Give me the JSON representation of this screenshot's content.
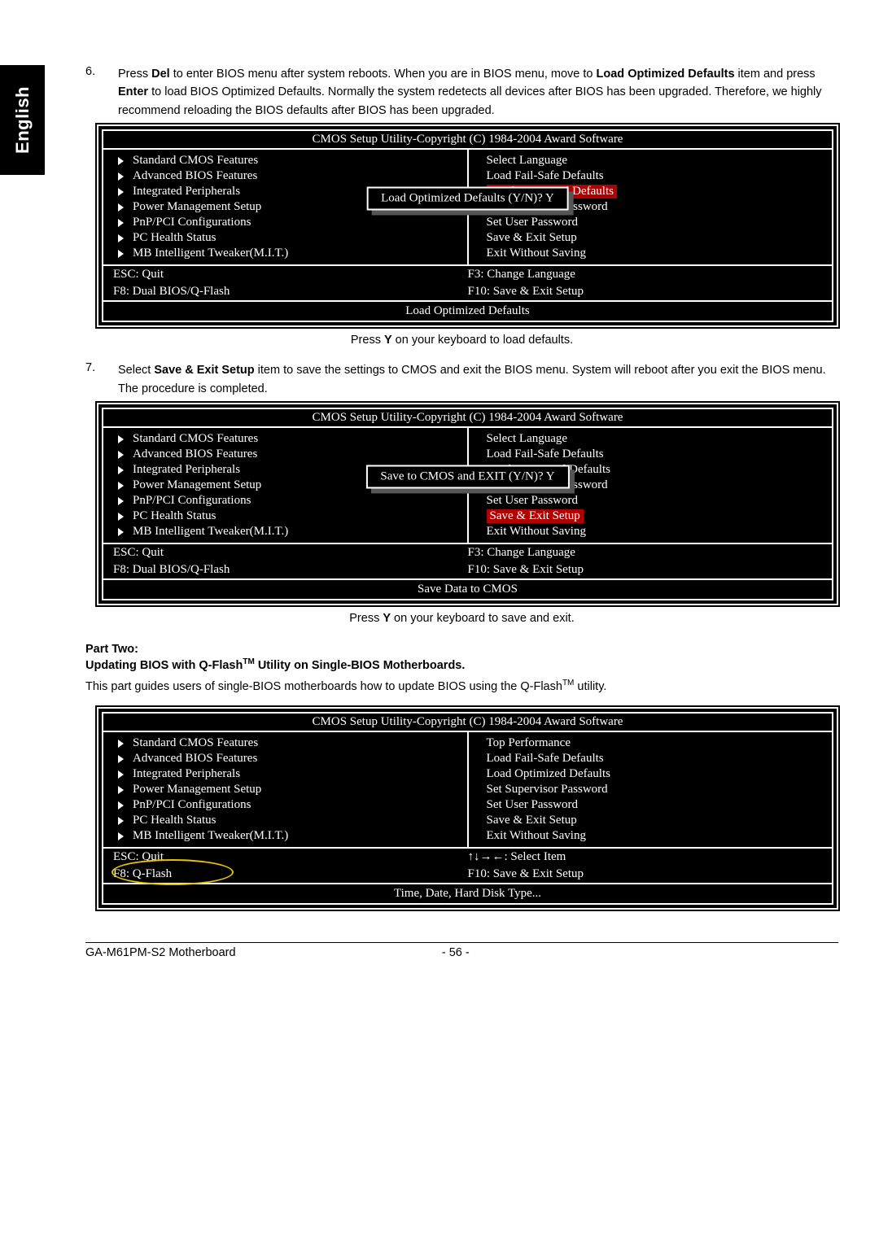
{
  "lang_tab": "English",
  "step6": {
    "num": "6.",
    "parts": [
      "Press ",
      "Del",
      " to enter BIOS menu after system reboots. When you are in BIOS menu, move to ",
      "Load Optimized Defaults",
      " item and press ",
      "Enter",
      " to load BIOS Optimized Defaults. Normally the system redetects all devices after BIOS has been upgraded. Therefore, we highly recommend reloading the BIOS defaults after BIOS has been upgraded."
    ]
  },
  "bios1": {
    "title": "CMOS Setup Utility-Copyright (C) 1984-2004 Award Software",
    "left": [
      "Standard CMOS Features",
      "Advanced BIOS Features",
      "Integrated Peripherals",
      "Power Management Setup",
      "PnP/PCI Configurations",
      "PC Health Status",
      "MB Intelligent Tweaker(M.I.T.)"
    ],
    "right": [
      "Select Language",
      "Load Fail-Safe Defaults",
      "Load Optimized Defaults",
      "Set Supervisor Password",
      "Set User Password",
      "Save & Exit Setup",
      "Exit Without Saving"
    ],
    "right_highlight_index": 2,
    "dialog": "Load Optimized Defaults (Y/N)? Y",
    "bb": [
      [
        "ESC: Quit",
        "F3: Change Language"
      ],
      [
        "F8: Dual BIOS/Q-Flash",
        "F10: Save & Exit Setup"
      ]
    ],
    "hint": "Load Optimized Defaults"
  },
  "cap1": {
    "pre": "Press ",
    "key": "Y",
    "post": " on your keyboard to load defaults."
  },
  "step7": {
    "num": "7.",
    "parts": [
      "Select ",
      "Save & Exit Setup",
      " item to save the settings to CMOS and exit the BIOS menu. System will reboot after you exit the BIOS menu. The procedure is completed."
    ]
  },
  "bios2": {
    "title": "CMOS Setup Utility-Copyright (C) 1984-2004 Award Software",
    "left": [
      "Standard CMOS Features",
      "Advanced BIOS Features",
      "Integrated Peripherals",
      "Power Management Setup",
      "PnP/PCI Configurations",
      "PC Health Status",
      "MB Intelligent Tweaker(M.I.T.)"
    ],
    "right": [
      "Select Language",
      "Load Fail-Safe Defaults",
      "Load Optimized Defaults",
      "Set Supervisor Password",
      "Set User Password",
      "Save & Exit Setup",
      "Exit Without Saving"
    ],
    "right_highlight_index": 5,
    "dialog": "Save to CMOS and EXIT (Y/N)? Y",
    "bb": [
      [
        "ESC: Quit",
        "F3: Change Language"
      ],
      [
        "F8: Dual BIOS/Q-Flash",
        "F10: Save & Exit Setup"
      ]
    ],
    "hint": "Save Data to CMOS"
  },
  "cap2": {
    "pre": "Press ",
    "key": "Y",
    "post": " on your keyboard to save and exit."
  },
  "part": {
    "head": "Part Two:",
    "sub_pre": "Updating BIOS with Q-Flash",
    "sub_tm": "TM",
    "sub_post": " Utility on Single-BIOS Motherboards.",
    "body_pre": "This part guides users of single-BIOS motherboards how to update BIOS using the Q-Flash",
    "body_tm": "TM",
    "body_post": " utility."
  },
  "bios3": {
    "title": "CMOS Setup Utility-Copyright (C) 1984-2004 Award Software",
    "left": [
      "Standard CMOS Features",
      "Advanced BIOS Features",
      "Integrated Peripherals",
      "Power Management Setup",
      "PnP/PCI Configurations",
      "PC Health Status",
      "MB Intelligent Tweaker(M.I.T.)"
    ],
    "right": [
      "Top Performance",
      "Load Fail-Safe Defaults",
      "Load Optimized Defaults",
      "Set Supervisor Password",
      "Set User Password",
      "Save & Exit Setup",
      "Exit Without Saving"
    ],
    "bb": [
      [
        "ESC: Quit",
        "↑↓→←: Select Item"
      ],
      [
        "F8: Q-Flash",
        "F10: Save & Exit Setup"
      ]
    ],
    "bb_circle_row": 1,
    "hint": "Time, Date, Hard Disk Type..."
  },
  "footer": {
    "left": "GA-M61PM-S2 Motherboard",
    "center": "- 56 -"
  }
}
